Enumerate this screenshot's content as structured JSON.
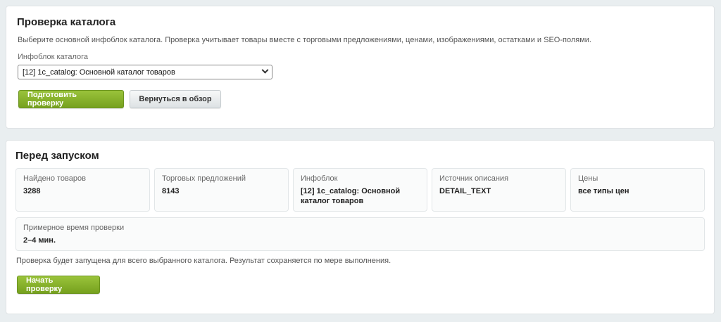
{
  "check_panel": {
    "title": "Проверка каталога",
    "description": "Выберите основной инфоблок каталога. Проверка учитывает товары вместе с торговыми предложениями, ценами, изображениями, остатками и SEO-полями.",
    "field_label": "Инфоблок каталога",
    "select_value": "[12] 1c_catalog: Основной каталог товаров",
    "prepare_button": "Подготовить проверку",
    "back_button": "Вернуться в обзор"
  },
  "before_panel": {
    "title": "Перед запуском",
    "stats": [
      {
        "label": "Найдено товаров",
        "value": "3288"
      },
      {
        "label": "Торговых предложений",
        "value": "8143"
      },
      {
        "label": "Инфоблок",
        "value": "[12] 1c_catalog: Основной каталог товаров"
      },
      {
        "label": "Источник описания",
        "value": "DETAIL_TEXT"
      },
      {
        "label": "Цены",
        "value": "все типы цен"
      }
    ],
    "time_card": {
      "label": "Примерное время проверки",
      "value": "2–4 мин."
    },
    "note": "Проверка будет запущена для всего выбранного каталога. Результат сохраняется по мере выполнения.",
    "start_button": "Начать проверку"
  },
  "colors": {
    "accent_green": "#86b02a",
    "background": "#e9eef0",
    "panel": "#ffffff"
  }
}
